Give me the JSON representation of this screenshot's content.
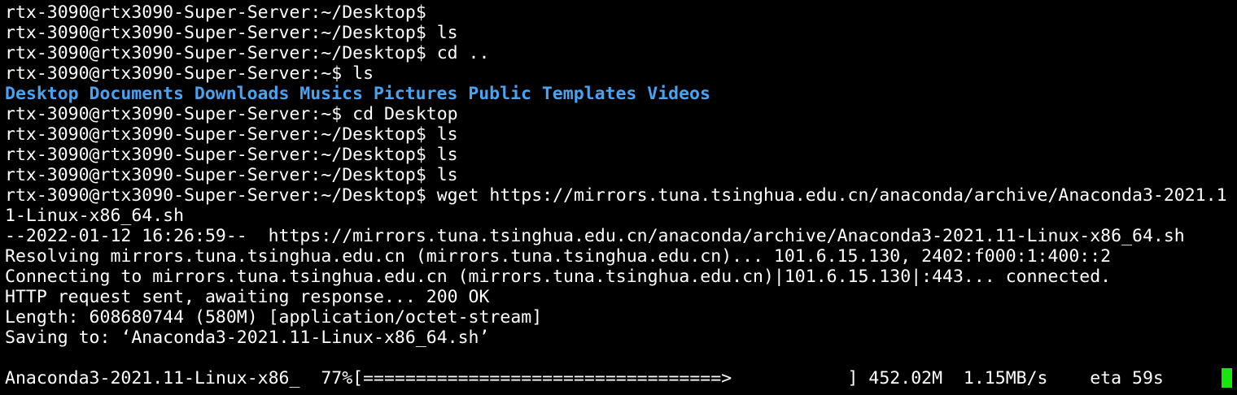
{
  "terminal": {
    "lines": [
      "rtx-3090@rtx3090-Super-Server:~/Desktop$",
      "rtx-3090@rtx3090-Super-Server:~/Desktop$ ls",
      "rtx-3090@rtx3090-Super-Server:~/Desktop$ cd ..",
      "rtx-3090@rtx3090-Super-Server:~$ ls"
    ],
    "dirs": [
      "Desktop",
      "Documents",
      "Downloads",
      "Musics",
      "Pictures",
      "Public",
      "Templates",
      "Videos"
    ],
    "lines2": [
      "rtx-3090@rtx3090-Super-Server:~$ cd Desktop",
      "rtx-3090@rtx3090-Super-Server:~/Desktop$ ls",
      "rtx-3090@rtx3090-Super-Server:~/Desktop$ ls",
      "rtx-3090@rtx3090-Super-Server:~/Desktop$ ls",
      "rtx-3090@rtx3090-Super-Server:~/Desktop$ wget https://mirrors.tuna.tsinghua.edu.cn/anaconda/archive/Anaconda3-2021.1",
      "1-Linux-x86_64.sh",
      "--2022-01-12 16:26:59--  https://mirrors.tuna.tsinghua.edu.cn/anaconda/archive/Anaconda3-2021.11-Linux-x86_64.sh",
      "Resolving mirrors.tuna.tsinghua.edu.cn (mirrors.tuna.tsinghua.edu.cn)... 101.6.15.130, 2402:f000:1:400::2",
      "Connecting to mirrors.tuna.tsinghua.edu.cn (mirrors.tuna.tsinghua.edu.cn)|101.6.15.130|:443... connected.",
      "HTTP request sent, awaiting response... 200 OK",
      "Length: 608680744 (580M) [application/octet-stream]",
      "Saving to: ‘Anaconda3-2021.11-Linux-x86_64.sh’",
      ""
    ],
    "progress_line": "Anaconda3-2021.11-Linux-x86_  77%[==================================>           ] 452.02M  1.15MB/s    eta 59s    ",
    "progress_percent": 77,
    "colors": {
      "background": "#000000",
      "text": "#ffffff",
      "directory": "#4aa3f0",
      "cursor": "#19e60e"
    }
  }
}
